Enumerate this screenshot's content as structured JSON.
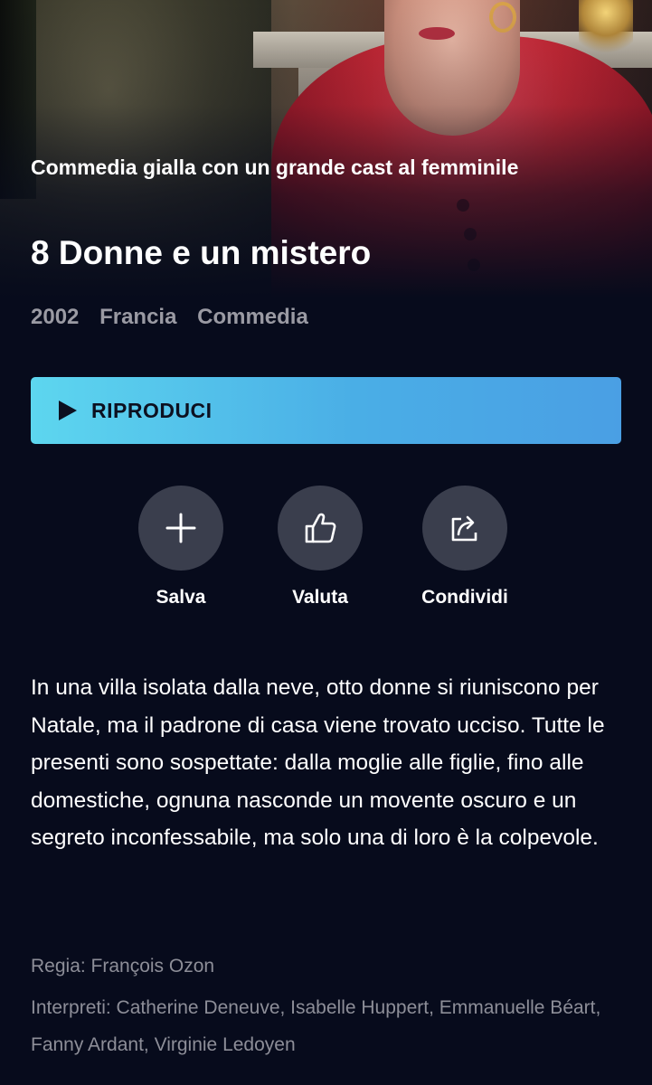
{
  "hero": {
    "subtitle": "Commedia gialla con un grande cast al femminile",
    "title": "8 Donne e un mistero"
  },
  "meta": {
    "year": "2002",
    "country": "Francia",
    "genre": "Commedia"
  },
  "play_button": {
    "label": "RIPRODUCI",
    "color_start": "#5dd6ef",
    "color_end": "#4a9fe4"
  },
  "actions": {
    "save": {
      "label": "Salva",
      "icon": "plus-icon"
    },
    "rate": {
      "label": "Valuta",
      "icon": "thumbs-up-icon"
    },
    "share": {
      "label": "Condividi",
      "icon": "share-icon"
    }
  },
  "description": "In una villa isolata dalla neve, otto donne si riuniscono per Natale, ma il padrone di casa viene trovato ucciso. Tutte le presenti sono sospettate: dalla moglie alle figlie, fino alle domestiche, ognuna nasconde un movente oscuro e un segreto inconfessabile, ma solo una di loro è la colpevole.",
  "credits": {
    "director": "Regia: François Ozon",
    "cast": "Interpreti: Catherine Deneuve, Isabelle Huppert, Emmanuelle Béart, Fanny Ardant, Virginie Ledoyen"
  },
  "colors": {
    "background": "#070b1c",
    "action_circle": "#3a3e4d",
    "meta_text": "#9a9aa3",
    "credit_text": "#8d8e98"
  }
}
